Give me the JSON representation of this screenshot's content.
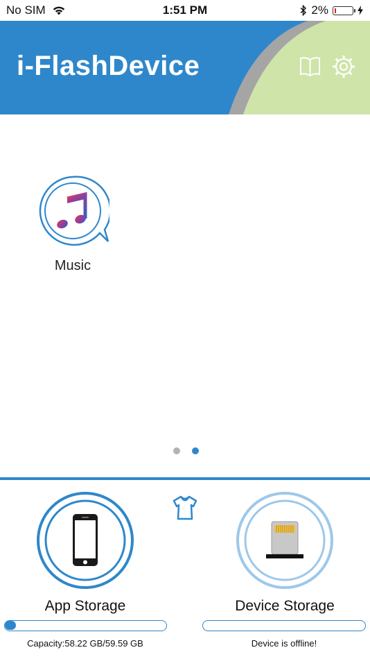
{
  "status": {
    "carrier": "No SIM",
    "time": "1:51 PM",
    "battery": "2%",
    "battery_level": 0.02
  },
  "header": {
    "title": "i-FlashDevice",
    "colors": {
      "primary": "#2f87cb",
      "accent": "#cfe4a9"
    },
    "icons": [
      "book-icon",
      "settings-gear-icon"
    ]
  },
  "apps": [
    {
      "label": "Music",
      "icon": "music-note-icon"
    }
  ],
  "pager": {
    "pages": 2,
    "active": 1
  },
  "storage": {
    "app": {
      "label": "App Storage",
      "capacity": "Capacity:58.22 GB/59.59 GB",
      "used_fraction": 0.03
    },
    "device": {
      "label": "Device Storage",
      "status": "Device is offline!"
    },
    "center_icon": "shirt-icon"
  }
}
